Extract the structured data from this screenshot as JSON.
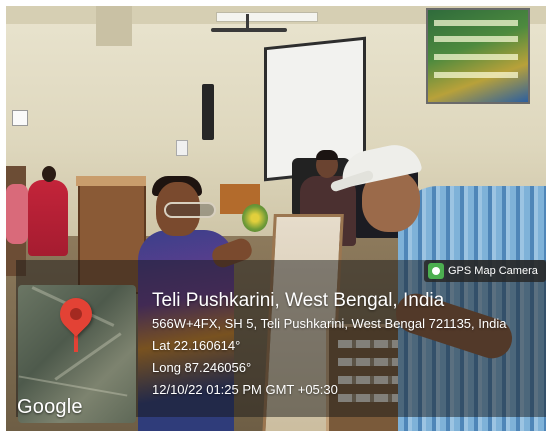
{
  "photo": {
    "description_icon": "photo-scene"
  },
  "overlay": {
    "badge_label": "GPS Map Camera",
    "place": "Teli Pushkarini, West Bengal, India",
    "address": "566W+4FX, SH 5, Teli Pushkarini, West Bengal 721135, India",
    "latitude": "Lat 22.160614°",
    "longitude": "Long 87.246056°",
    "timestamp": "12/10/22 01:25 PM GMT +05:30",
    "map_brand": "Google"
  },
  "colors": {
    "pin": "#e34235",
    "badge_icon": "#4caf50",
    "overlay_text": "#ffffff"
  }
}
